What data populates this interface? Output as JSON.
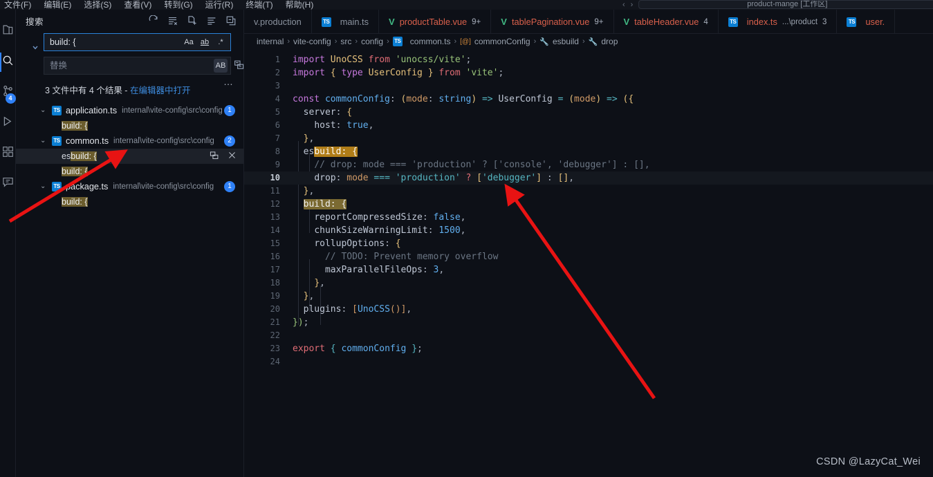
{
  "titlebar": {
    "menus": [
      "文件(F)",
      "编辑(E)",
      "选择(S)",
      "查看(V)",
      "转到(G)",
      "运行(R)",
      "终端(T)",
      "帮助(H)"
    ],
    "nav_back": "‹",
    "nav_forward": "›",
    "search_box_text": "product-mange [工作区]"
  },
  "activitybar": {
    "items": [
      {
        "name": "explorer-icon",
        "label": "资源管理器",
        "badge": ""
      },
      {
        "name": "search-icon",
        "label": "搜索",
        "badge": ""
      },
      {
        "name": "source-control-icon",
        "label": "源代码管理",
        "badge": "4"
      },
      {
        "name": "run-debug-icon",
        "label": "运行和调试",
        "badge": ""
      },
      {
        "name": "extensions-icon",
        "label": "扩展",
        "badge": ""
      },
      {
        "name": "comments-icon",
        "label": "注释",
        "badge": ""
      }
    ]
  },
  "sidebar": {
    "title": "搜索",
    "actions": [
      {
        "name": "refresh-icon",
        "label": "刷新"
      },
      {
        "name": "clear-results-icon",
        "label": "清除搜索结果"
      },
      {
        "name": "new-search-editor-icon",
        "label": "在编辑器中打开新的搜索"
      },
      {
        "name": "view-as-list-icon",
        "label": "以列表形式查看"
      },
      {
        "name": "collapse-all-icon",
        "label": "全部折叠"
      }
    ],
    "search": {
      "value": "build: {",
      "placeholder": "搜索",
      "toggle_replace_label": "切换替换",
      "options": [
        {
          "name": "match-case-option",
          "glyph": "Aa",
          "checked": false
        },
        {
          "name": "match-whole-word-option",
          "glyph": "ab",
          "checked": false
        },
        {
          "name": "use-regex-option",
          "glyph": ".*",
          "checked": false
        }
      ]
    },
    "replace": {
      "value": "",
      "placeholder": "替换",
      "preserve_case_glyph": "AB",
      "replace_all_label": "全部替换"
    },
    "more_actions": "…",
    "summary": {
      "text": "3 文件中有 4 个结果 - ",
      "link": "在编辑器中打开"
    },
    "results": [
      {
        "file": "application.ts",
        "path": "internal\\vite-config\\src\\config",
        "count": "1",
        "icon": "TS",
        "expanded": true,
        "matches": [
          {
            "pre": "",
            "hit": "build: {",
            "post": "",
            "selected": false
          }
        ]
      },
      {
        "file": "common.ts",
        "path": "internal\\vite-config\\src\\config",
        "count": "2",
        "icon": "TS",
        "expanded": true,
        "matches": [
          {
            "pre": "es",
            "hit": "build: {",
            "post": "",
            "selected": true
          },
          {
            "pre": "",
            "hit": "build: {",
            "post": "",
            "selected": false
          }
        ]
      },
      {
        "file": "package.ts",
        "path": "internal\\vite-config\\src\\config",
        "count": "1",
        "icon": "TS",
        "expanded": true,
        "matches": [
          {
            "pre": "",
            "hit": "build: {",
            "post": "",
            "selected": false
          }
        ]
      }
    ],
    "match_actions": [
      {
        "name": "replace-match-icon",
        "label": "替换"
      },
      {
        "name": "dismiss-match-icon",
        "label": "消除"
      }
    ]
  },
  "editor": {
    "tabs": [
      {
        "name": "tab-env-production",
        "label": "v.production",
        "icon": "",
        "suffix": "",
        "badge": "",
        "active": false,
        "plain": true
      },
      {
        "name": "tab-main-ts",
        "label": "main.ts",
        "icon": "TS",
        "suffix": "",
        "badge": "",
        "active": false,
        "plain": true
      },
      {
        "name": "tab-product-table-vue",
        "label": "productTable.vue",
        "icon": "V",
        "suffix": "",
        "badge": "9+",
        "active": false,
        "plain": false
      },
      {
        "name": "tab-table-pagination-vue",
        "label": "tablePagination.vue",
        "icon": "V",
        "suffix": "",
        "badge": "9+",
        "active": false,
        "plain": false
      },
      {
        "name": "tab-table-header-vue",
        "label": "tableHeader.vue",
        "icon": "V",
        "suffix": "",
        "badge": "4",
        "active": false,
        "plain": false
      },
      {
        "name": "tab-index-ts",
        "label": "index.ts",
        "icon": "TS",
        "suffix": "...\\product",
        "badge": "3",
        "active": false,
        "plain": false
      },
      {
        "name": "tab-user-ts",
        "label": "user.",
        "icon": "TS",
        "suffix": "",
        "badge": "",
        "active": false,
        "plain": false
      }
    ],
    "breadcrumb": [
      {
        "label": "internal",
        "icon": ""
      },
      {
        "label": "vite-config",
        "icon": ""
      },
      {
        "label": "src",
        "icon": ""
      },
      {
        "label": "config",
        "icon": ""
      },
      {
        "label": "common.ts",
        "icon": "TS"
      },
      {
        "label": "commonConfig",
        "icon": "obj"
      },
      {
        "label": "esbuild",
        "icon": "wrench"
      },
      {
        "label": "drop",
        "icon": "wrench"
      }
    ],
    "current_line": 10,
    "lines": [
      {
        "n": "1",
        "text": "import UnoCSS from 'unocss/vite';"
      },
      {
        "n": "2",
        "text": "import { type UserConfig } from 'vite';"
      },
      {
        "n": "3",
        "text": ""
      },
      {
        "n": "4",
        "text": "const commonConfig: (mode: string) => UserConfig = (mode) => ({"
      },
      {
        "n": "5",
        "text": "  server: {"
      },
      {
        "n": "6",
        "text": "    host: true,"
      },
      {
        "n": "7",
        "text": "  },"
      },
      {
        "n": "8",
        "text": "  esbuild: {"
      },
      {
        "n": "9",
        "text": "    // drop: mode === 'production' ? ['console', 'debugger'] : [],"
      },
      {
        "n": "10",
        "text": "    drop: mode === 'production' ? ['debugger'] : [],"
      },
      {
        "n": "11",
        "text": "  },"
      },
      {
        "n": "12",
        "text": "  build: {"
      },
      {
        "n": "13",
        "text": "    reportCompressedSize: false,"
      },
      {
        "n": "14",
        "text": "    chunkSizeWarningLimit: 1500,"
      },
      {
        "n": "15",
        "text": "    rollupOptions: {"
      },
      {
        "n": "16",
        "text": "      // TODO: Prevent memory overflow"
      },
      {
        "n": "17",
        "text": "      maxParallelFileOps: 3,"
      },
      {
        "n": "18",
        "text": "    },"
      },
      {
        "n": "19",
        "text": "  },"
      },
      {
        "n": "20",
        "text": "  plugins: [UnoCSS()],"
      },
      {
        "n": "21",
        "text": "});"
      },
      {
        "n": "22",
        "text": ""
      },
      {
        "n": "23",
        "text": "export { commonConfig };"
      },
      {
        "n": "24",
        "text": ""
      }
    ]
  },
  "watermark": "CSDN @LazyCat_Wei",
  "colors": {
    "accent": "#2f81f7",
    "search_match_current": "#b07d18",
    "search_match_other": "#7b6a32",
    "background": "#0d1017",
    "annotation_arrow": "#e81313"
  }
}
